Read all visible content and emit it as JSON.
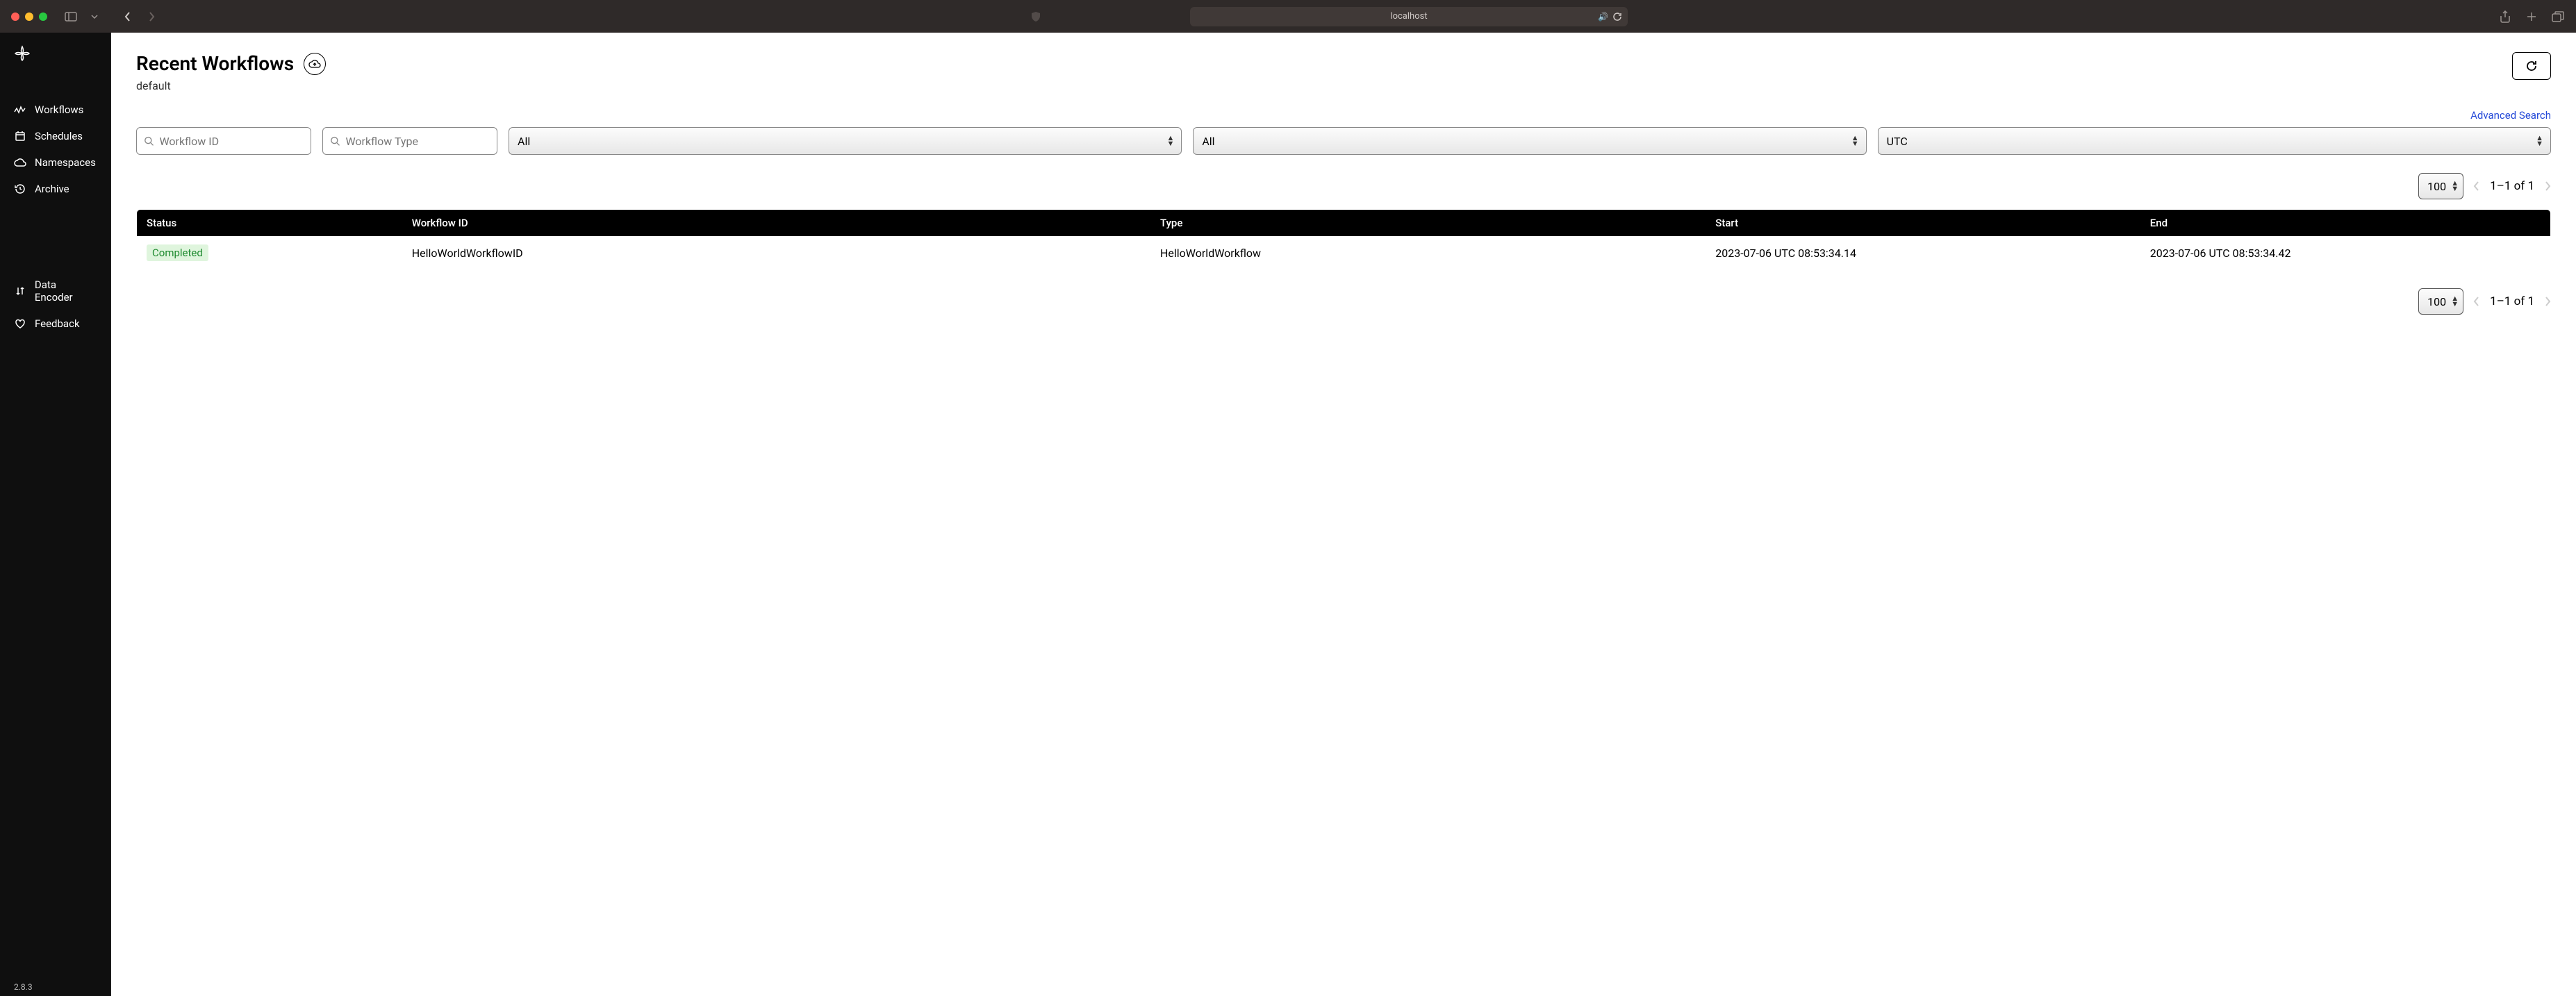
{
  "browser": {
    "url": "localhost"
  },
  "sidebar": {
    "items": [
      {
        "label": "Workflows"
      },
      {
        "label": "Schedules"
      },
      {
        "label": "Namespaces"
      },
      {
        "label": "Archive"
      },
      {
        "label": "Data Encoder"
      },
      {
        "label": "Feedback"
      }
    ],
    "version": "2.8.3"
  },
  "header": {
    "title": "Recent Workflows",
    "subtitle": "default"
  },
  "filters": {
    "workflow_id_placeholder": "Workflow ID",
    "workflow_type_placeholder": "Workflow Type",
    "status_selected": "All",
    "time_selected": "All",
    "tz_selected": "UTC",
    "advanced_search": "Advanced Search"
  },
  "pagination": {
    "page_size": "100",
    "range_text": "1–1 of 1"
  },
  "table": {
    "columns": [
      "Status",
      "Workflow ID",
      "Type",
      "Start",
      "End"
    ],
    "rows": [
      {
        "status": "Completed",
        "workflow_id": "HelloWorldWorkflowID",
        "type": "HelloWorldWorkflow",
        "start": "2023-07-06 UTC 08:53:34.14",
        "end": "2023-07-06 UTC 08:53:34.42"
      }
    ]
  }
}
